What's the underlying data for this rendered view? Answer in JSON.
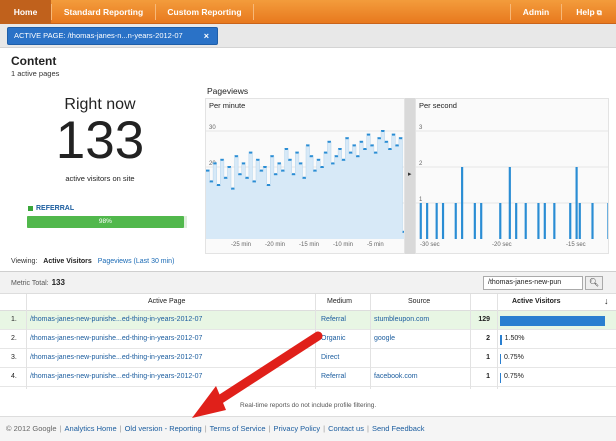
{
  "nav": {
    "home": "Home",
    "standard": "Standard Reporting",
    "custom": "Custom Reporting",
    "admin": "Admin",
    "help": "Help"
  },
  "active_page": {
    "prefix": "ACTIVE PAGE:",
    "value": "/thomas-janes-n...n-years-2012-07",
    "close": "×"
  },
  "content": {
    "title": "Content",
    "subtitle": "1 active pages"
  },
  "right_now": {
    "label": "Right now",
    "count": "133",
    "sub": "active visitors on site",
    "referral_label": "REFERRAL",
    "referral_pct": "98%",
    "referral_fill": 0.98
  },
  "pageviews": {
    "title": "Pageviews",
    "per_minute": "Per minute",
    "per_second": "Per second",
    "min_ticks": [
      "30",
      "20",
      "10"
    ],
    "min_xlabels": [
      "-25 min",
      "-20 min",
      "-15 min",
      "-10 min",
      "-5 min"
    ],
    "sec_ticks": [
      "3",
      "2",
      "1"
    ],
    "sec_xlabels": [
      "-30 sec",
      "-20 sec",
      "-15 sec"
    ],
    "per_minute_values": [
      19,
      16,
      21,
      15,
      22,
      17,
      20,
      14,
      23,
      18,
      21,
      17,
      24,
      16,
      22,
      19,
      20,
      15,
      23,
      18,
      21,
      19,
      25,
      22,
      18,
      24,
      21,
      17,
      26,
      23,
      19,
      22,
      20,
      24,
      27,
      21,
      23,
      25,
      22,
      28,
      24,
      26,
      23,
      27,
      25,
      29,
      26,
      24,
      28,
      30,
      27,
      25,
      29,
      26,
      28,
      2
    ],
    "per_second_values": [
      0,
      1,
      0,
      1,
      0,
      0,
      1,
      0,
      1,
      0,
      0,
      0,
      1,
      0,
      2,
      0,
      0,
      0,
      1,
      0,
      1,
      0,
      0,
      0,
      0,
      0,
      1,
      0,
      0,
      2,
      0,
      1,
      0,
      0,
      1,
      0,
      0,
      0,
      1,
      0,
      1,
      0,
      0,
      1,
      0,
      0,
      0,
      0,
      1,
      0,
      2,
      1,
      0,
      0,
      0,
      1,
      0,
      0,
      0,
      0,
      1
    ]
  },
  "viewing": {
    "label": "Viewing:",
    "active": "Active Visitors",
    "other": "Pageviews (Last 30 min)"
  },
  "table": {
    "metric_label": "Metric Total:",
    "metric_total": "133",
    "search_value": "/thomas-janes-new-pun",
    "columns": [
      "Active Page",
      "Medium",
      "Source",
      "Active Visitors"
    ],
    "sort_icon": "↓",
    "rows": [
      {
        "n": "1.",
        "page": "/thomas-janes-new-punishe...ed-thing-in-years-2012-07",
        "medium": "Referral",
        "source": "stumbleupon.com",
        "visitors": "129",
        "pct": "96.99%",
        "fill": 0.9699
      },
      {
        "n": "2.",
        "page": "/thomas-janes-new-punishe...ed-thing-in-years-2012-07",
        "medium": "Organic",
        "source": "google",
        "visitors": "2",
        "pct": "1.50%",
        "fill": 0.015
      },
      {
        "n": "3.",
        "page": "/thomas-janes-new-punishe...ed-thing-in-years-2012-07",
        "medium": "Direct",
        "source": "",
        "visitors": "1",
        "pct": "0.75%",
        "fill": 0.0075
      },
      {
        "n": "4.",
        "page": "/thomas-janes-new-punishe...ed-thing-in-years-2012-07",
        "medium": "Referral",
        "source": "facebook.com",
        "visitors": "1",
        "pct": "0.75%",
        "fill": 0.0075
      }
    ]
  },
  "note": "Real-time reports do not include profile filtering.",
  "footer": {
    "copyright": "© 2012 Google",
    "links": [
      "Analytics Home",
      "Old version - Reporting",
      "Terms of Service",
      "Privacy Policy",
      "Contact us",
      "Send Feedback"
    ]
  },
  "colors": {
    "accent": "#e8791e",
    "bar_blue": "#2a7fd0",
    "referral_green": "#51b84c"
  }
}
